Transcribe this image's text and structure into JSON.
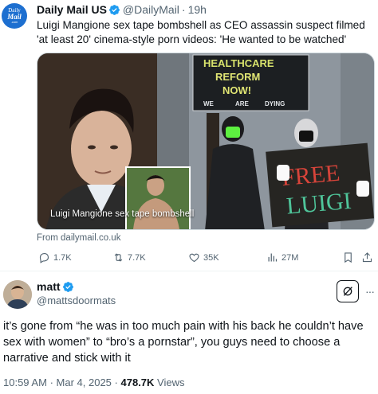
{
  "quoted_post": {
    "author_name": "Daily Mail US",
    "handle": "@DailyMail",
    "separator": "·",
    "time": "19h",
    "logo": {
      "line1": "Daily",
      "line2": "Mail",
      "line3": ".com"
    },
    "text": "Luigi Mangione sex tape bombshell as CEO assassin suspect filmed 'at least 20' cinema-style porn videos: 'He wanted to be watched'",
    "card": {
      "caption": "Luigi Mangione sex tape bombshell",
      "sign_top": [
        "HEALTHCARE",
        "REFORM",
        "NOW!"
      ],
      "sign_bottom": [
        "WE",
        "ARE",
        "DYING"
      ],
      "sign_free": [
        "FREE",
        "LUIGI"
      ]
    },
    "source": "From dailymail.co.uk",
    "actions": {
      "replies": "1.7K",
      "reposts": "7.7K",
      "likes": "35K",
      "views": "27M"
    }
  },
  "main_post": {
    "author_name": "matt",
    "handle": "@mattsdoormats",
    "text": "it’s gone from “he was in too much pain with his back he couldn’t have sex with women” to “bro’s a pornstar”, you guys need to choose a narrative and stick with it",
    "time": "10:59 AM",
    "separator": "·",
    "date": "Mar 4, 2025",
    "separator2": "·",
    "views_count": "478.7K",
    "views_label": "Views"
  },
  "colors": {
    "verified": "#1d9bf0",
    "secondary": "#536471",
    "text": "#0f1419",
    "brand": "#1d6fd0"
  }
}
